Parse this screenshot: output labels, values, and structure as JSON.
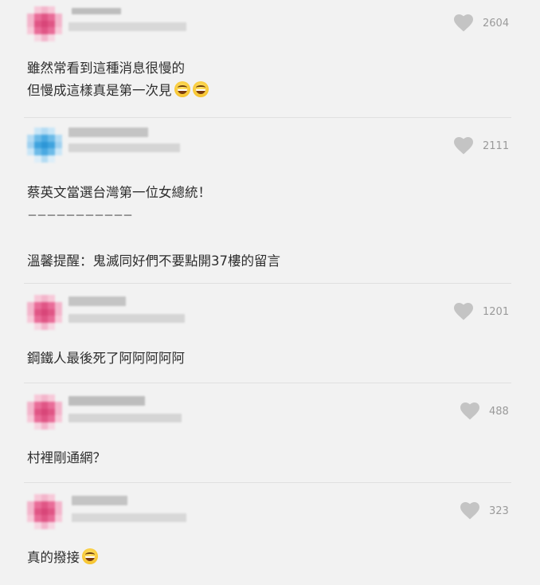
{
  "comments": [
    {
      "likes": "2604",
      "lines": [
        "雖然常看到這種消息很慢的",
        "但慢成這樣真是第一次見"
      ],
      "emojis_after_last_line": [
        "grinning-sweat-emoji",
        "grinning-sweat-emoji"
      ],
      "avatar_color": "#e05585"
    },
    {
      "likes": "2111",
      "lines": [
        "蔡英文當選台灣第一位女總統！",
        "－－－－－－－－－－－",
        "",
        "溫馨提醒：鬼滅同好們不要點開37樓的留言"
      ],
      "avatar_color": "#3fa3de"
    },
    {
      "likes": "1201",
      "lines": [
        "鋼鐵人最後死了阿阿阿阿阿"
      ],
      "avatar_color": "#e05585"
    },
    {
      "likes": "488",
      "lines": [
        "村裡剛通網？"
      ],
      "avatar_color": "#e05585"
    },
    {
      "likes": "323",
      "lines": [
        "真的撥接"
      ],
      "emojis_after_last_line": [
        "grinning-sweat-emoji"
      ],
      "avatar_color": "#e05585"
    }
  ],
  "colors": {
    "background": "#f2f2f2",
    "text": "#2e2e2e",
    "like_icon": "#c4c4c4",
    "like_count": "#9a9a9a",
    "divider": "#e0e0e0"
  },
  "icons": {
    "like": "heart-icon",
    "emoji": "grinning-sweat-emoji"
  }
}
